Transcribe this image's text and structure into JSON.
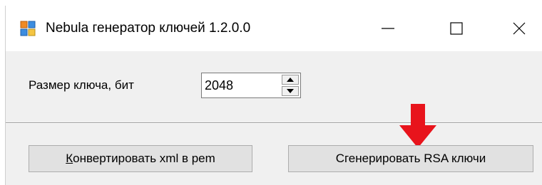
{
  "window": {
    "title": "Nebula генератор ключей 1.2.0.0",
    "icon": "app-window-icon",
    "controls": {
      "minimize": "minimize-icon",
      "maximize": "maximize-icon",
      "close": "close-icon"
    }
  },
  "form": {
    "key_size_label": "Размер ключа, бит",
    "key_size_value": "2048"
  },
  "buttons": {
    "convert_mnemonic": "К",
    "convert_rest": "онвертировать xml в pem",
    "generate_label": "Сгенерировать RSA ключи"
  },
  "annotation": {
    "arrow_icon": "arrow-down-icon",
    "arrow_color": "#e8141c"
  }
}
